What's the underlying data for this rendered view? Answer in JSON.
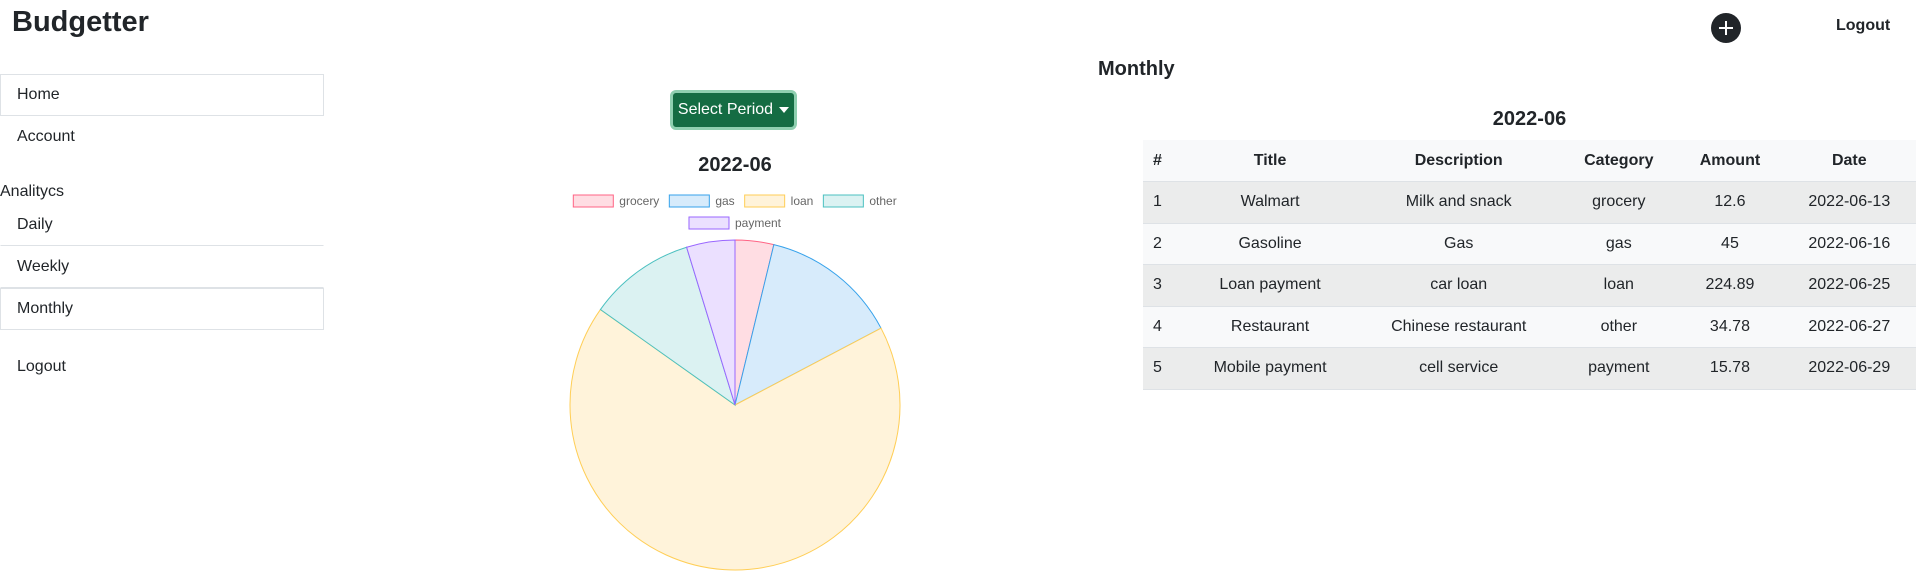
{
  "app": {
    "brand": "Budgetter",
    "logout": "Logout",
    "add_icon": "plus-circle-icon"
  },
  "sidebar": {
    "home": "Home",
    "account": "Account",
    "heading": "Analitycs",
    "daily": "Daily",
    "weekly": "Weekly",
    "monthly": "Monthly",
    "logout": "Logout"
  },
  "main": {
    "section_title": "Monthly",
    "select_period_label": "Select Period"
  },
  "chart_data": {
    "type": "pie",
    "title": "2022-06",
    "categories": [
      "grocery",
      "gas",
      "loan",
      "other",
      "payment"
    ],
    "values": [
      12.6,
      45,
      224.89,
      34.78,
      15.78
    ],
    "colors": {
      "border": [
        "#ff6384",
        "#36a2eb",
        "#ffce56",
        "#4bc0c0",
        "#9966ff"
      ],
      "fill": [
        "#ffdde3",
        "#d7ebfb",
        "#fff3da",
        "#dbf2f2",
        "#ebe0ff"
      ]
    },
    "legend_position": "top"
  },
  "table": {
    "caption": "2022-06",
    "headers": [
      "#",
      "Title",
      "Description",
      "Category",
      "Amount",
      "Date"
    ],
    "rows": [
      [
        "1",
        "Walmart",
        "Milk and snack",
        "grocery",
        "12.6",
        "2022-06-13"
      ],
      [
        "2",
        "Gasoline",
        "Gas",
        "gas",
        "45",
        "2022-06-16"
      ],
      [
        "3",
        "Loan payment",
        "car loan",
        "loan",
        "224.89",
        "2022-06-25"
      ],
      [
        "4",
        "Restaurant",
        "Chinese restaurant",
        "other",
        "34.78",
        "2022-06-27"
      ],
      [
        "5",
        "Mobile payment",
        "cell service",
        "payment",
        "15.78",
        "2022-06-29"
      ]
    ]
  }
}
